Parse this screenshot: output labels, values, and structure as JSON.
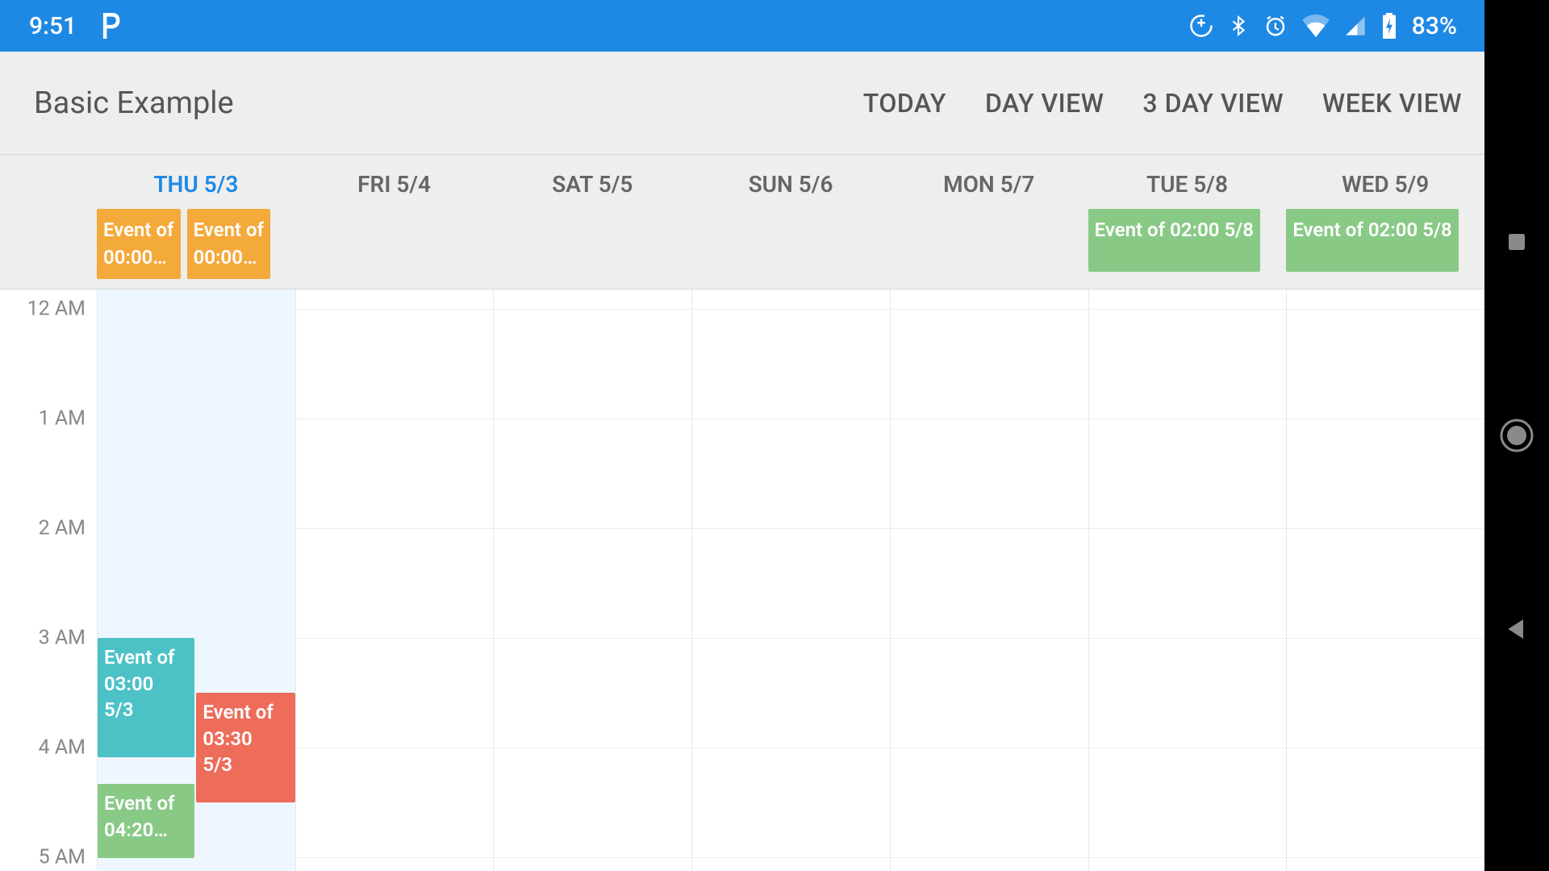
{
  "status": {
    "time": "9:51",
    "battery": "83%"
  },
  "header": {
    "title": "Basic Example",
    "buttons": {
      "today": "TODAY",
      "day": "DAY VIEW",
      "three_day": "3 DAY VIEW",
      "week": "WEEK VIEW"
    }
  },
  "days": [
    {
      "label": "THU 5/3",
      "today": true
    },
    {
      "label": "FRI 5/4",
      "today": false
    },
    {
      "label": "SAT 5/5",
      "today": false
    },
    {
      "label": "SUN 5/6",
      "today": false
    },
    {
      "label": "MON 5/7",
      "today": false
    },
    {
      "label": "TUE 5/8",
      "today": false
    },
    {
      "label": "WED 5/9",
      "today": false
    }
  ],
  "colors": {
    "orange": "#f4a93b",
    "green": "#88c986",
    "teal": "#4cc2c6",
    "red": "#ed6c5a"
  },
  "allday": {
    "thu": {
      "ev1_l1": "Event of",
      "ev1_l2": "00:00…",
      "ev2_l1": "Event of",
      "ev2_l2": "00:00…"
    },
    "tue": {
      "label": "Event of 02:00 5/8"
    },
    "wed": {
      "label": "Event of 02:00 5/8"
    }
  },
  "hours": {
    "h0": "12 AM",
    "h1": "1 AM",
    "h2": "2 AM",
    "h3": "3 AM",
    "h4": "4 AM",
    "h5": "5 AM"
  },
  "timed": {
    "ev_teal_l1": "Event of",
    "ev_teal_l2": "03:00",
    "ev_teal_l3": "5/3",
    "ev_red_l1": "Event of",
    "ev_red_l2": "03:30",
    "ev_red_l3": "5/3",
    "ev_green_l1": "Event of",
    "ev_green_l2": "04:20…"
  },
  "nav_icons": {
    "recent": "recent-apps-icon",
    "home": "home-icon",
    "back": "back-icon"
  },
  "status_icons": {
    "app": "pandora-icon",
    "update": "system-update-icon",
    "bluetooth": "bluetooth-icon",
    "alarm": "alarm-icon",
    "wifi": "wifi-icon",
    "signal": "cell-signal-icon",
    "battery": "battery-charging-icon"
  }
}
